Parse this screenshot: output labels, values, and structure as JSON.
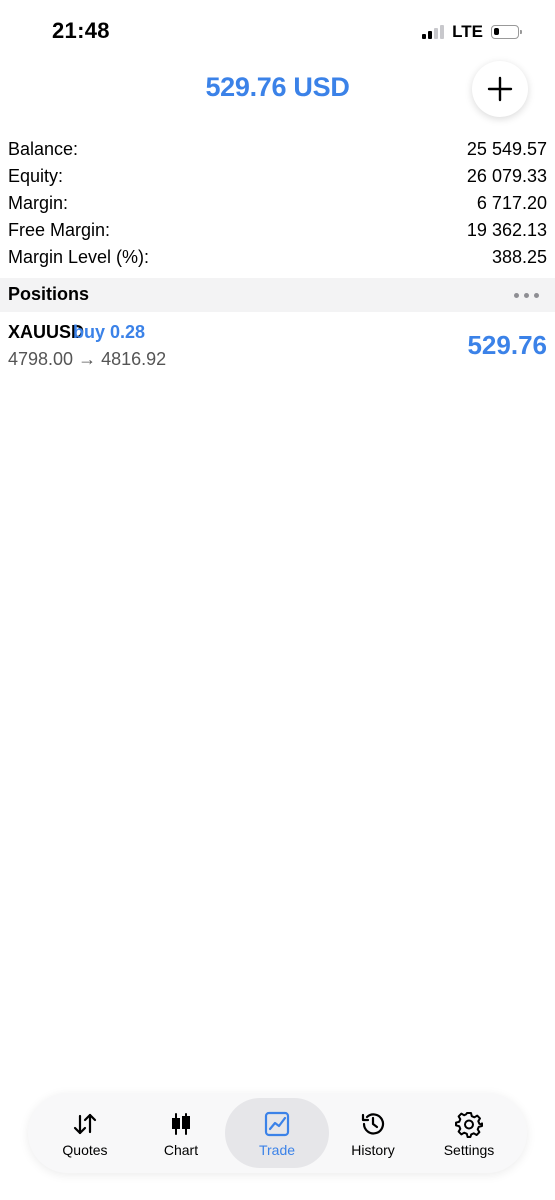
{
  "status_bar": {
    "time": "21:48",
    "network": "LTE",
    "signal_bars_active": 2,
    "signal_bars_total": 4,
    "battery_level": 0.25
  },
  "header": {
    "title": "529.76 USD",
    "add_icon": "plus-icon"
  },
  "summary": [
    {
      "label": "Balance:",
      "value": "25 549.57"
    },
    {
      "label": "Equity:",
      "value": "26 079.33"
    },
    {
      "label": "Margin:",
      "value": "6 717.20"
    },
    {
      "label": "Free Margin:",
      "value": "19 362.13"
    },
    {
      "label": "Margin Level (%):",
      "value": "388.25"
    }
  ],
  "positions": {
    "title": "Positions",
    "more_icon": "more-dots-icon",
    "items": [
      {
        "symbol": "XAUUSD",
        "side": "buy 0.28",
        "prices": "4798.00 → 4816.92",
        "profit": "529.76"
      }
    ]
  },
  "tabs": [
    {
      "label": "Quotes",
      "icon": "quotes-arrows-icon",
      "active": false
    },
    {
      "label": "Chart",
      "icon": "candlestick-chart-icon",
      "active": false
    },
    {
      "label": "Trade",
      "icon": "trade-chart-icon",
      "active": true
    },
    {
      "label": "History",
      "icon": "history-clock-icon",
      "active": false
    },
    {
      "label": "Settings",
      "icon": "gear-icon",
      "active": false
    }
  ],
  "colors": {
    "accent": "#3b82e8",
    "section_bg": "#f3f3f4",
    "tab_active_bg": "#e6e6e9"
  }
}
